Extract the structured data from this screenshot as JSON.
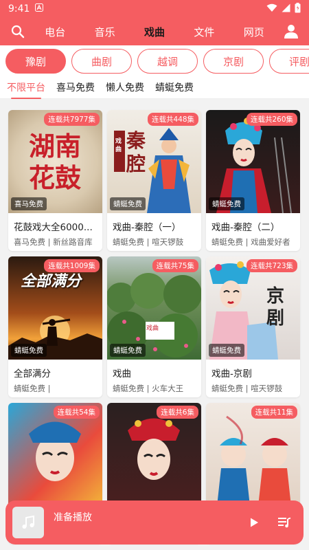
{
  "status_bar": {
    "time": "9:41"
  },
  "nav": {
    "tabs": [
      {
        "label": "电台",
        "active": false
      },
      {
        "label": "音乐",
        "active": false
      },
      {
        "label": "戏曲",
        "active": true
      },
      {
        "label": "文件",
        "active": false
      },
      {
        "label": "网页",
        "active": false
      }
    ]
  },
  "genres": [
    {
      "label": "豫剧",
      "active": true
    },
    {
      "label": "曲剧",
      "active": false
    },
    {
      "label": "越调",
      "active": false
    },
    {
      "label": "京剧",
      "active": false
    },
    {
      "label": "评剧",
      "active": false
    }
  ],
  "platforms": [
    {
      "label": "不限平台",
      "active": true
    },
    {
      "label": "喜马免费",
      "active": false
    },
    {
      "label": "懒人免费",
      "active": false
    },
    {
      "label": "蜻蜓免费",
      "active": false
    }
  ],
  "cards": [
    {
      "title": "花鼓戏大全6000...",
      "subtitle": "喜马免费 | 新丝路音库",
      "episodes": "连载共7977集",
      "source": "喜马免费",
      "cover_text": "湖南花鼓"
    },
    {
      "title": "戏曲-秦腔（一）",
      "subtitle": "蜻蜓免费 | 喧天锣鼓",
      "episodes": "连载共448集",
      "source": "蜻蜓免费",
      "cover_text": "秦腔",
      "cover_small": "戏曲"
    },
    {
      "title": "戏曲-秦腔（二）",
      "subtitle": "蜻蜓免费 | 戏曲爱好者",
      "episodes": "连载共260集",
      "source": "蜻蜓免费"
    },
    {
      "title": "全部满分",
      "subtitle": "蜻蜓免费 |",
      "episodes": "连载共1009集",
      "source": "蜻蜓免费",
      "cover_text": "全部满分"
    },
    {
      "title": "戏曲",
      "subtitle": "蜻蜓免费 | 火车大王",
      "episodes": "连载共75集",
      "source": "蜻蜓免费",
      "cover_text": "戏曲"
    },
    {
      "title": "戏曲-京剧",
      "subtitle": "蜻蜓免费 | 喧天锣鼓",
      "episodes": "连载共723集",
      "source": "蜻蜓免费",
      "cover_text": "京剧"
    },
    {
      "title": "",
      "subtitle": "",
      "episodes": "连载共54集",
      "source": ""
    },
    {
      "title": "",
      "subtitle": "",
      "episodes": "连载共6集",
      "source": ""
    },
    {
      "title": "",
      "subtitle": "",
      "episodes": "连载共11集",
      "source": ""
    }
  ],
  "player": {
    "title": "准备播放"
  },
  "icons": {
    "search": "search-icon",
    "account": "account-icon",
    "music_note": "music-note-icon",
    "play": "play-icon",
    "playlist": "playlist-icon"
  },
  "colors": {
    "accent": "#f55d61"
  }
}
